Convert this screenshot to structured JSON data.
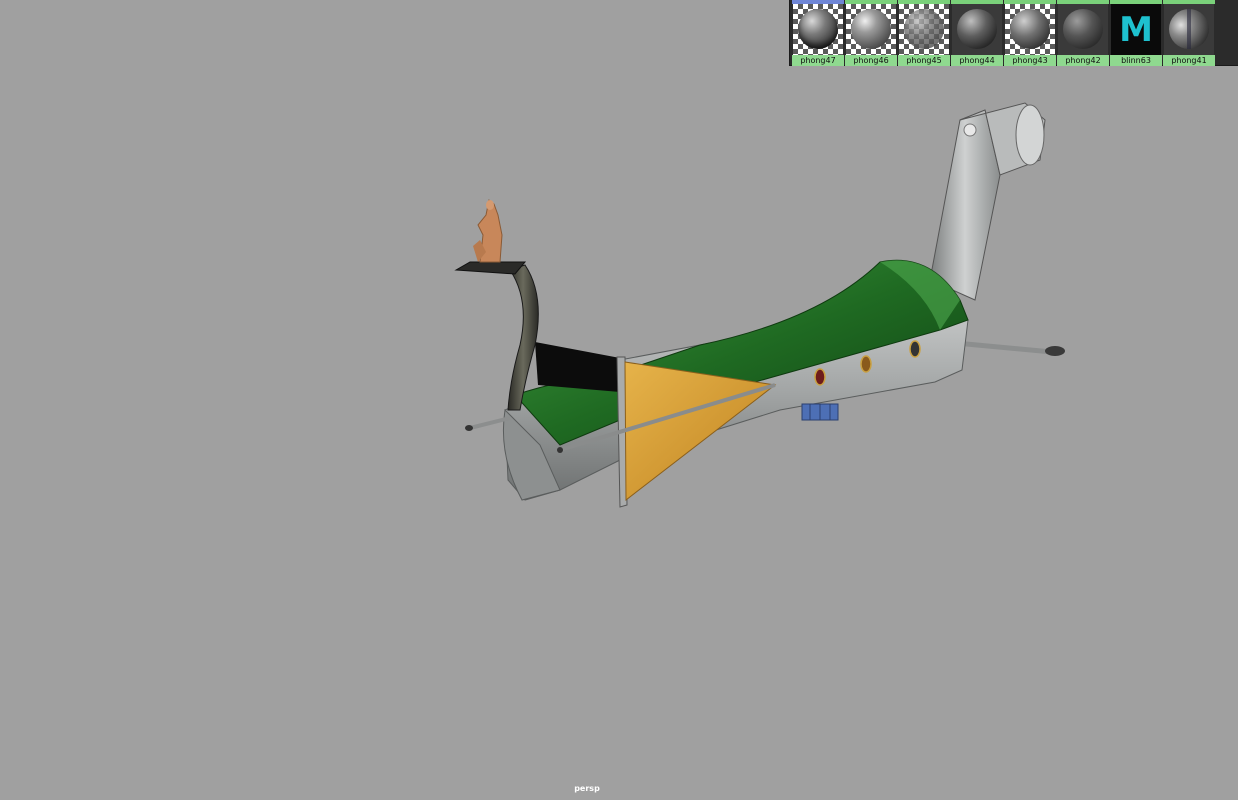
{
  "viewport": {
    "camera_label": "persp",
    "background_color": "#a0a0a0"
  },
  "hypershade_swatches": [
    {
      "name": "phong47",
      "thumb": "checker",
      "selected": true
    },
    {
      "name": "phong46",
      "thumb": "checker",
      "selected": false
    },
    {
      "name": "phong45",
      "thumb": "checker",
      "selected": false
    },
    {
      "name": "phong44",
      "thumb": "dark",
      "selected": false
    },
    {
      "name": "phong43",
      "thumb": "checker",
      "selected": false
    },
    {
      "name": "phong42",
      "thumb": "dark",
      "selected": false
    },
    {
      "name": "blinn63",
      "thumb": "maya-logo",
      "selected": false,
      "logo_text": "M"
    },
    {
      "name": "phong41",
      "thumb": "dark",
      "selected": false
    }
  ],
  "colors": {
    "swatch_label_bg": "#8fd98f",
    "swatch_top_selected": "#6f86d6",
    "hull_grey": "#9b9d9d",
    "canopy_green": "#2f7d2f",
    "sail_gold": "#d9a23a",
    "figurehead": "#c8875a"
  }
}
